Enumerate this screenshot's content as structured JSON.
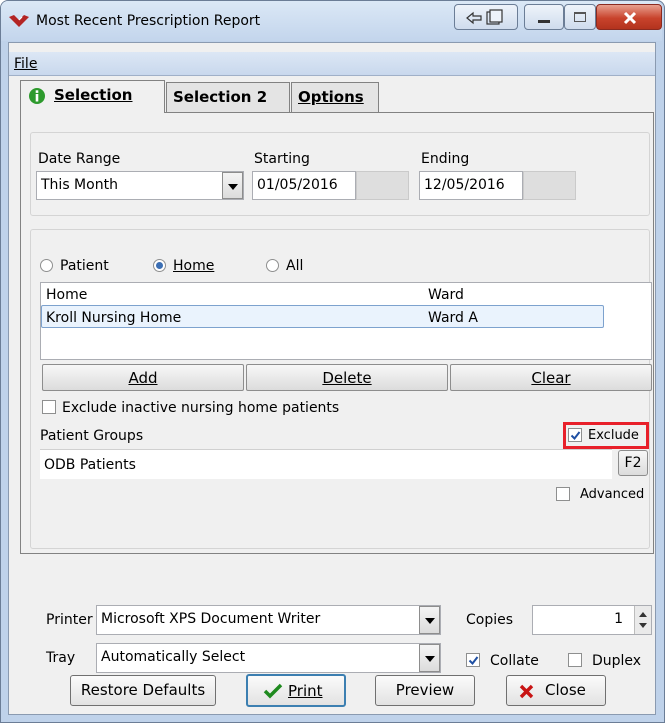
{
  "window": {
    "title": "Most Recent Prescription Report"
  },
  "menu": {
    "file": "File"
  },
  "tabs": [
    {
      "label": "Selection",
      "active": true
    },
    {
      "label": "Selection 2",
      "active": false
    },
    {
      "label": "Options",
      "active": false
    }
  ],
  "date": {
    "range_label": "Date Range",
    "range_value": "This Month",
    "starting_label": "Starting",
    "starting_value": "01/05/2016",
    "ending_label": "Ending",
    "ending_value": "12/05/2016"
  },
  "scope": {
    "options": [
      "Patient",
      "Home",
      "All"
    ],
    "selected": "Home",
    "columns": [
      "Home",
      "Ward"
    ],
    "rows": [
      {
        "home": "Kroll Nursing Home",
        "ward": "Ward A"
      }
    ],
    "add": "Add",
    "delete": "Delete",
    "clear": "Clear",
    "exclude_inactive": "Exclude inactive nursing home patients",
    "exclude_inactive_checked": false
  },
  "groups": {
    "label": "Patient Groups",
    "exclude_label": "Exclude",
    "exclude_checked": true,
    "items": [
      "ODB Patients"
    ],
    "f2": "F2",
    "advanced_label": "Advanced",
    "advanced_checked": false
  },
  "print": {
    "printer_label": "Printer",
    "printer_value": "Microsoft XPS Document Writer",
    "copies_label": "Copies",
    "copies_value": "1",
    "tray_label": "Tray",
    "tray_value": "Automatically Select",
    "collate_label": "Collate",
    "collate_checked": true,
    "duplex_label": "Duplex",
    "duplex_checked": false
  },
  "buttons": {
    "restore": "Restore Defaults",
    "print": "Print",
    "preview": "Preview",
    "close": "Close"
  },
  "colors": {
    "highlight_box": "#e8202a",
    "check_mark": "#1e4fa3",
    "close_x": "#c81414",
    "print_check": "#1f8a1f",
    "info_icon": "#2d9a2d"
  }
}
